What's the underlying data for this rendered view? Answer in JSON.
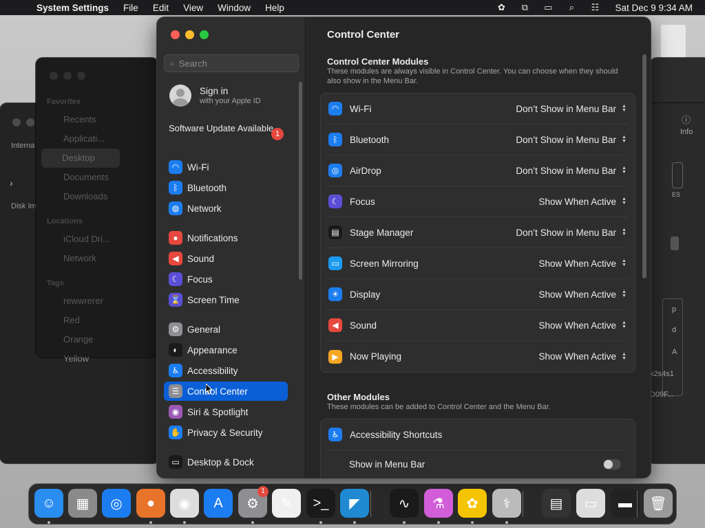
{
  "menubar": {
    "app_name": "System Settings",
    "menus": [
      "File",
      "Edit",
      "View",
      "Window",
      "Help"
    ],
    "clock": "Sat Dec 9  9:34 AM"
  },
  "background": {
    "finder_sections": {
      "favorites": "Favorites",
      "locations": "Locations",
      "tags": "Tags"
    },
    "finder_items": [
      "Recents",
      "Applicati...",
      "Desktop",
      "Documents",
      "Downloads"
    ],
    "location_items": [
      "iCloud Dri...",
      "Network"
    ],
    "tag_items": [
      "rewwrerer",
      "Red",
      "Orange",
      "Yellow"
    ],
    "disk_window_labels": [
      "Interna",
      "Disk Im"
    ],
    "right_labels": [
      "Info",
      "ES",
      "p",
      "d",
      "A",
      "k2s4s1",
      "D09F..."
    ]
  },
  "sidebar": {
    "search_placeholder": "Search",
    "signin_title": "Sign in",
    "signin_sub": "with your Apple ID",
    "update_text": "Software Update Available",
    "update_badge": "1",
    "items": [
      {
        "label": "Wi-Fi",
        "color": "#1c7df0",
        "icon": "wifi-icon",
        "glyph": "◠"
      },
      {
        "label": "Bluetooth",
        "color": "#1c7df0",
        "icon": "bluetooth-icon",
        "glyph": "ᛒ"
      },
      {
        "label": "Network",
        "color": "#1c7df0",
        "icon": "globe-icon",
        "glyph": "◍"
      },
      {
        "label": "Notifications",
        "color": "#e5483e",
        "icon": "bell-icon",
        "glyph": "●"
      },
      {
        "label": "Sound",
        "color": "#e5483e",
        "icon": "speaker-icon",
        "glyph": "◀"
      },
      {
        "label": "Focus",
        "color": "#5b4fd6",
        "icon": "moon-icon",
        "glyph": "☾"
      },
      {
        "label": "Screen Time",
        "color": "#5b4fd6",
        "icon": "hourglass-icon",
        "glyph": "⌛"
      },
      {
        "label": "General",
        "color": "#8e8e93",
        "icon": "gear-icon",
        "glyph": "⚙"
      },
      {
        "label": "Appearance",
        "color": "#1a1a1a",
        "icon": "appearance-icon",
        "glyph": "◐"
      },
      {
        "label": "Accessibility",
        "color": "#1c7df0",
        "icon": "accessibility-icon",
        "glyph": "♿"
      },
      {
        "label": "Control Center",
        "color": "#8e8e93",
        "icon": "control-center-icon",
        "glyph": "☰"
      },
      {
        "label": "Siri & Spotlight",
        "color": "#9b59b6",
        "icon": "siri-icon",
        "glyph": "◉"
      },
      {
        "label": "Privacy & Security",
        "color": "#1c7df0",
        "icon": "hand-icon",
        "glyph": "✋"
      },
      {
        "label": "Desktop & Dock",
        "color": "#1a1a1a",
        "icon": "dock-icon",
        "glyph": "▭"
      }
    ]
  },
  "content": {
    "title": "Control Center",
    "modules_title": "Control Center Modules",
    "modules_desc": "These modules are always visible in Control Center. You can choose when they should also show in the Menu Bar.",
    "modules": [
      {
        "label": "Wi-Fi",
        "value": "Don’t Show in Menu Bar",
        "color": "#1c7df0",
        "icon": "wifi-icon",
        "glyph": "◠"
      },
      {
        "label": "Bluetooth",
        "value": "Don’t Show in Menu Bar",
        "color": "#1c7df0",
        "icon": "bluetooth-icon",
        "glyph": "ᛒ"
      },
      {
        "label": "AirDrop",
        "value": "Don’t Show in Menu Bar",
        "color": "#1c7df0",
        "icon": "airdrop-icon",
        "glyph": "◎"
      },
      {
        "label": "Focus",
        "value": "Show When Active",
        "color": "#5b4fd6",
        "icon": "moon-icon",
        "glyph": "☾"
      },
      {
        "label": "Stage Manager",
        "value": "Don’t Show in Menu Bar",
        "color": "#1a1a1a",
        "icon": "stage-manager-icon",
        "glyph": "▤"
      },
      {
        "label": "Screen Mirroring",
        "value": "Show When Active",
        "color": "#1c9bf0",
        "icon": "screen-mirroring-icon",
        "glyph": "▭"
      },
      {
        "label": "Display",
        "value": "Show When Active",
        "color": "#1c7df0",
        "icon": "sun-icon",
        "glyph": "☀"
      },
      {
        "label": "Sound",
        "value": "Show When Active",
        "color": "#e5483e",
        "icon": "speaker-icon",
        "glyph": "◀"
      },
      {
        "label": "Now Playing",
        "value": "Show When Active",
        "color": "#f5a623",
        "icon": "play-icon",
        "glyph": "▶"
      }
    ],
    "other_title": "Other Modules",
    "other_desc": "These modules can be added to Control Center and the Menu Bar.",
    "other": [
      {
        "label": "Accessibility Shortcuts",
        "color": "#1c7df0",
        "icon": "accessibility-icon",
        "glyph": "♿"
      }
    ],
    "show_in_menu_bar": "Show in Menu Bar"
  },
  "dock": {
    "apps": [
      {
        "name": "finder",
        "color": "#2a8df0",
        "glyph": "☺",
        "running": true
      },
      {
        "name": "launchpad",
        "color": "#8a8a8a",
        "glyph": "▦",
        "running": false
      },
      {
        "name": "safari",
        "color": "#1c7df0",
        "glyph": "◎",
        "running": false
      },
      {
        "name": "firefox",
        "color": "#e8742a",
        "glyph": "●",
        "running": true
      },
      {
        "name": "chrome",
        "color": "#dddddd",
        "glyph": "◉",
        "running": true
      },
      {
        "name": "app-store",
        "color": "#1c7df0",
        "glyph": "A",
        "running": false
      },
      {
        "name": "system-settings",
        "color": "#8e8e93",
        "glyph": "⚙",
        "running": true,
        "badge": "1"
      },
      {
        "name": "textedit",
        "color": "#f0f0f0",
        "glyph": "✎",
        "running": false
      },
      {
        "name": "terminal",
        "color": "#1a1a1a",
        "glyph": ">_",
        "running": true
      },
      {
        "name": "vscode",
        "color": "#1f8ad2",
        "glyph": "◤",
        "running": true
      },
      {
        "name": "activity-monitor",
        "color": "#1a1a1a",
        "glyph": "∿",
        "running": true
      },
      {
        "name": "potion-app",
        "color": "#d15ed8",
        "glyph": "⚗",
        "running": true
      },
      {
        "name": "bee-app",
        "color": "#f5c400",
        "glyph": "✿",
        "running": true
      },
      {
        "name": "disk-utility",
        "color": "#bbbbbb",
        "glyph": "⚕",
        "running": true
      },
      {
        "name": "preview-window-1",
        "color": "#333333",
        "glyph": "▤",
        "running": false
      },
      {
        "name": "preview-window-2",
        "color": "#dddddd",
        "glyph": "▭",
        "running": false
      },
      {
        "name": "preview-window-3",
        "color": "#222222",
        "glyph": "▬",
        "running": false
      },
      {
        "name": "trash",
        "color": "#9a9a9a",
        "glyph": "🗑",
        "running": false
      }
    ]
  }
}
